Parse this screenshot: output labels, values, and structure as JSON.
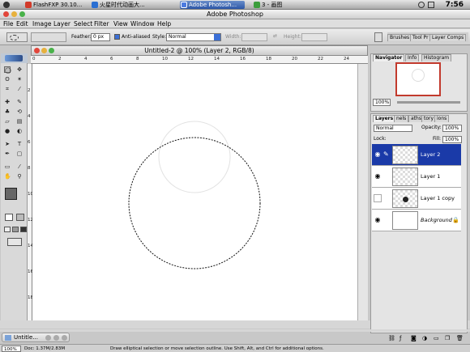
{
  "taskbar": {
    "items": [
      {
        "label": "FlashFXP  30.10...",
        "active": false
      },
      {
        "label": "火星时代动画大...",
        "active": false
      },
      {
        "label": "Adobe Photosh...",
        "active": true
      },
      {
        "label": "3 - 画图",
        "active": false
      }
    ],
    "clock": "7:56"
  },
  "app": {
    "title": "Adobe Photoshop"
  },
  "menu": [
    "File",
    "Edit",
    "Image",
    "Layer",
    "Select",
    "Filter",
    "View",
    "Window",
    "Help"
  ],
  "options": {
    "feather_label": "Feather:",
    "feather_value": "0 px",
    "antialias_label": "Anti-aliased",
    "antialias_checked": true,
    "style_label": "Style:",
    "style_value": "Normal",
    "width_label": "Width:",
    "height_label": "Height:",
    "palette_tabs": [
      "Brushes",
      "Tool Pr",
      "Layer Comps"
    ]
  },
  "document": {
    "title": "Untitled-2 @ 100% (Layer 2, RGB/8)",
    "zoom": "100%",
    "doc_size": "Doc: 1.37M/2.83M",
    "status_hint": "Draw elliptical selection or move selection outline.  Use Shift, Alt, and Ctrl for additional options."
  },
  "ruler": {
    "h": [
      "0",
      "2",
      "4",
      "6",
      "8",
      "10",
      "12",
      "14",
      "16",
      "18",
      "20",
      "22",
      "24"
    ],
    "v": [
      "2",
      "4",
      "6",
      "8",
      "10",
      "12",
      "14",
      "16",
      "18"
    ]
  },
  "navigator": {
    "tabs": [
      "Navigator",
      "Info",
      "Histogram"
    ],
    "zoom": "100%"
  },
  "layers_panel": {
    "tabs": [
      "Layers",
      "nels",
      "aths",
      "tory",
      "ions"
    ],
    "blend_mode": "Normal",
    "opacity_label": "Opacity:",
    "opacity": "100%",
    "lock_label": "Lock:",
    "fill_label": "Fill:",
    "fill": "100%",
    "layers": [
      {
        "name": "Layer 2",
        "selected": true,
        "visible": true
      },
      {
        "name": "Layer 1",
        "selected": false,
        "visible": true
      },
      {
        "name": "Layer 1 copy",
        "selected": false,
        "visible": false
      },
      {
        "name": "Background",
        "selected": false,
        "visible": true
      }
    ]
  },
  "minimized_doc": {
    "title": "Untitle..."
  },
  "colors": {
    "taskbar_active": "#2c57a8",
    "layer_selected": "#1a3aa8",
    "scroll": "#5b8fd5"
  }
}
